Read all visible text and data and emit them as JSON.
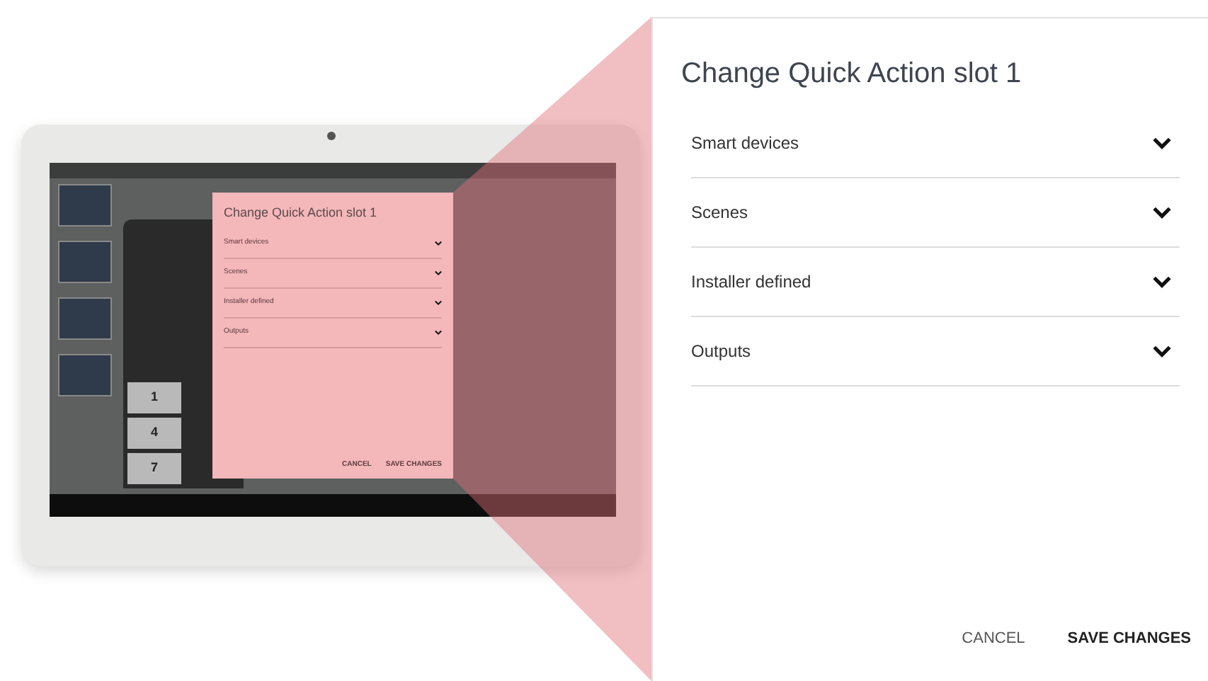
{
  "tablet": {
    "keypad_keys": [
      "1",
      "4",
      "7"
    ],
    "dialog": {
      "title": "Change Quick Action slot 1",
      "sections": [
        {
          "label": "Smart devices"
        },
        {
          "label": "Scenes"
        },
        {
          "label": "Installer defined"
        },
        {
          "label": "Outputs"
        }
      ],
      "buttons": [
        "CANCEL",
        "SAVE CHANGES"
      ]
    }
  },
  "dialog": {
    "title": "Change Quick Action slot 1",
    "sections": [
      {
        "label": "Smart devices",
        "expanded": false
      },
      {
        "label": "Scenes",
        "expanded": false
      },
      {
        "label": "Installer defined",
        "expanded": false
      },
      {
        "label": "Outputs",
        "expanded": false
      }
    ],
    "buttons": [
      {
        "label": "CANCEL",
        "kind": "secondary"
      },
      {
        "label": "SAVE CHANGES",
        "kind": "primary"
      }
    ]
  }
}
